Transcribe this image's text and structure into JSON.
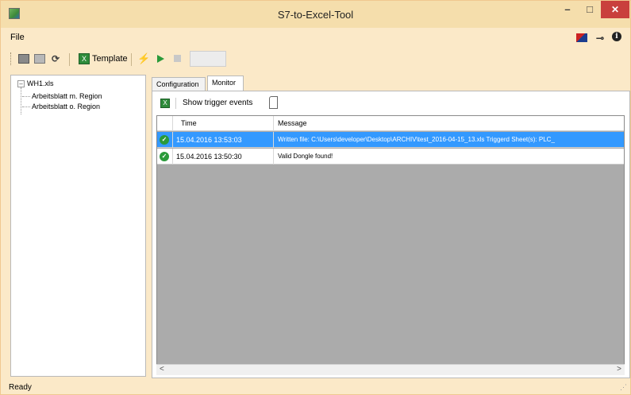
{
  "window": {
    "title": "S7-to-Excel-Tool",
    "minimize": "–",
    "maximize": "□",
    "close": "✕"
  },
  "menu": {
    "file": "File"
  },
  "toolbar": {
    "template_label": "Template",
    "refresh_glyph": "⟳",
    "trigger_glyph": "⚡"
  },
  "tree": {
    "root": "WH1.xls",
    "expander": "–",
    "children": [
      "Arbeitsblatt m. Region",
      "Arbeitsblatt o. Region"
    ]
  },
  "tabs": {
    "configuration": "Configuration",
    "monitor": "Monitor"
  },
  "monitor": {
    "show_trigger_events": "Show trigger events",
    "columns": {
      "time": "Time",
      "message": "Message"
    },
    "rows": [
      {
        "time": "15.04.2016 13:53:03",
        "message": "Written file: C:\\Users\\developer\\Desktop\\ARCHIV\\test_2016-04-15_13.xls Triggerd Sheet(s): PLC_",
        "selected": true
      },
      {
        "time": "15.04.2016 13:50:30",
        "message": "Valid Dongle found!",
        "selected": false
      }
    ]
  },
  "status": {
    "text": "Ready"
  },
  "colors": {
    "chrome": "#fbe9c8",
    "selection": "#3399ff",
    "close_button": "#c9403d",
    "success": "#2a9a3a"
  }
}
